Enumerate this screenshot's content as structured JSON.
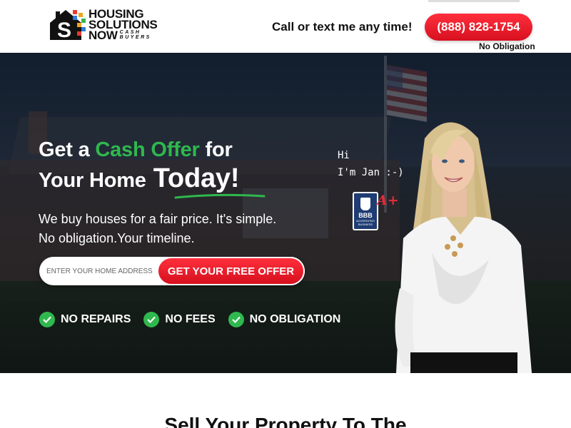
{
  "header": {
    "logo": {
      "line1": "HOUSING",
      "line2": "SOLUTIONS",
      "line3": "NOW",
      "sub1": "CASH",
      "sub2": "BUYERS"
    },
    "call_text": "Call or text me any time!",
    "phone": "(888) 828-1754",
    "phone_note": "No Obligation"
  },
  "hero": {
    "headline_part1": "Get a ",
    "headline_green": "Cash Offer",
    "headline_part2": " for",
    "headline_line2": "Your Home",
    "headline_today": "Today!",
    "subtext_line1": "We buy houses for a fair price. It's simple.",
    "subtext_line2": "No obligation.Your timeline.",
    "address_placeholder": "ENTER YOUR HOME ADDRESS",
    "offer_button": "GET YOUR FREE OFFER",
    "checks": [
      "NO REPAIRS",
      "NO FEES",
      "NO OBLIGATION"
    ],
    "greeting_line1": "Hi",
    "greeting_line2": "I'm Jan :-)",
    "bbb": {
      "letters": "BBB",
      "accredited": "ACCREDITED BUSINESS",
      "rating": "A+"
    }
  },
  "section": {
    "title_partial": "Sell Your Property To The"
  },
  "colors": {
    "accent_red": "#e0141f",
    "accent_green": "#2fb84e",
    "bbb_blue": "#1f3c73"
  },
  "icons": [
    "logo-house-icon",
    "check-icon",
    "bbb-torch-icon"
  ]
}
